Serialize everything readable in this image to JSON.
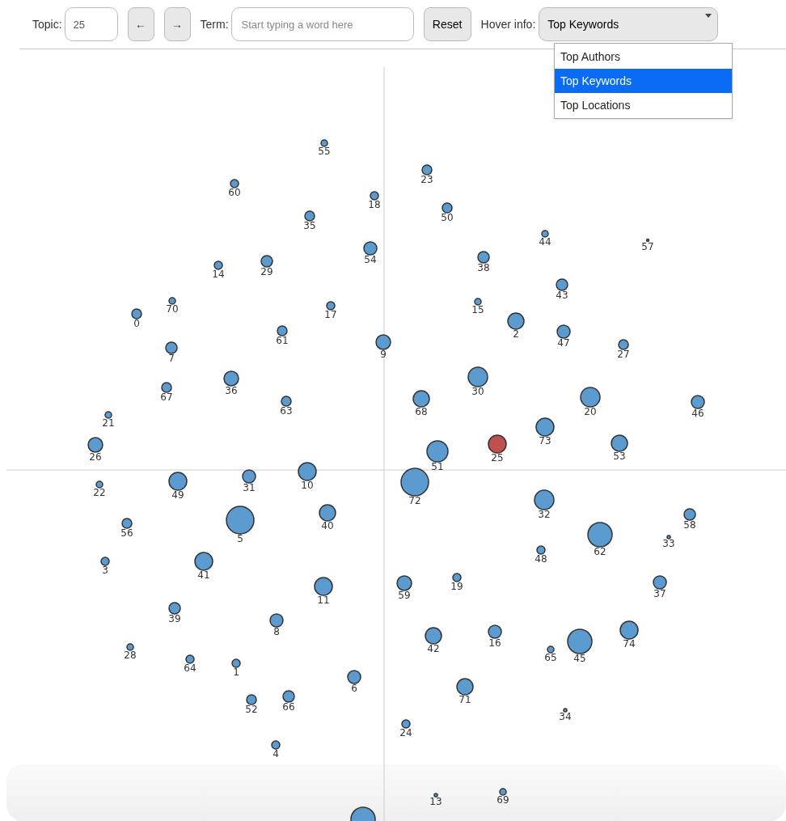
{
  "toolbar": {
    "topic_label": "Topic:",
    "topic_value": "25",
    "prev_button": "←",
    "next_button": "→",
    "term_label": "Term:",
    "term_placeholder": "Start typing a word here",
    "reset_button": "Reset",
    "hover_label": "Hover info:",
    "hover_value": "Top Keywords",
    "hover_expanded": true,
    "hover_options": [
      {
        "label": "Top Authors",
        "selected": false
      },
      {
        "label": "Top Keywords",
        "selected": true
      },
      {
        "label": "Top Locations",
        "selected": false
      }
    ]
  },
  "topics": [
    {
      "label": "55",
      "selected": false
    },
    {
      "label": "23",
      "selected": false
    },
    {
      "label": "60",
      "selected": false
    },
    {
      "label": "18",
      "selected": false
    },
    {
      "label": "50",
      "selected": false
    },
    {
      "label": "35",
      "selected": false
    },
    {
      "label": "44",
      "selected": false
    },
    {
      "label": "57",
      "selected": false
    },
    {
      "label": "54",
      "selected": false
    },
    {
      "label": "14",
      "selected": false
    },
    {
      "label": "29",
      "selected": false
    },
    {
      "label": "38",
      "selected": false
    },
    {
      "label": "43",
      "selected": false
    },
    {
      "label": "70",
      "selected": false
    },
    {
      "label": "17",
      "selected": false
    },
    {
      "label": "15",
      "selected": false
    },
    {
      "label": "0",
      "selected": false
    },
    {
      "label": "2",
      "selected": false
    },
    {
      "label": "61",
      "selected": false
    },
    {
      "label": "47",
      "selected": false
    },
    {
      "label": "7",
      "selected": false
    },
    {
      "label": "9",
      "selected": false
    },
    {
      "label": "27",
      "selected": false
    },
    {
      "label": "67",
      "selected": false
    },
    {
      "label": "36",
      "selected": false
    },
    {
      "label": "30",
      "selected": false
    },
    {
      "label": "63",
      "selected": false
    },
    {
      "label": "68",
      "selected": false
    },
    {
      "label": "20",
      "selected": false
    },
    {
      "label": "46",
      "selected": false
    },
    {
      "label": "21",
      "selected": false
    },
    {
      "label": "73",
      "selected": false
    },
    {
      "label": "26",
      "selected": false
    },
    {
      "label": "25",
      "selected": true
    },
    {
      "label": "53",
      "selected": false
    },
    {
      "label": "51",
      "selected": false
    },
    {
      "label": "22",
      "selected": false
    },
    {
      "label": "49",
      "selected": false
    },
    {
      "label": "31",
      "selected": false
    },
    {
      "label": "10",
      "selected": false
    },
    {
      "label": "72",
      "selected": false
    },
    {
      "label": "32",
      "selected": false
    },
    {
      "label": "40",
      "selected": false
    },
    {
      "label": "58",
      "selected": false
    },
    {
      "label": "56",
      "selected": false
    },
    {
      "label": "5",
      "selected": false
    },
    {
      "label": "33",
      "selected": false
    },
    {
      "label": "62",
      "selected": false
    },
    {
      "label": "48",
      "selected": false
    },
    {
      "label": "3",
      "selected": false
    },
    {
      "label": "41",
      "selected": false
    },
    {
      "label": "19",
      "selected": false
    },
    {
      "label": "11",
      "selected": false
    },
    {
      "label": "59",
      "selected": false
    },
    {
      "label": "37",
      "selected": false
    },
    {
      "label": "39",
      "selected": false
    },
    {
      "label": "8",
      "selected": false
    },
    {
      "label": "28",
      "selected": false
    },
    {
      "label": "42",
      "selected": false
    },
    {
      "label": "16",
      "selected": false
    },
    {
      "label": "65",
      "selected": false
    },
    {
      "label": "45",
      "selected": false
    },
    {
      "label": "74",
      "selected": false
    },
    {
      "label": "64",
      "selected": false
    },
    {
      "label": "1",
      "selected": false
    },
    {
      "label": "6",
      "selected": false
    },
    {
      "label": "71",
      "selected": false
    },
    {
      "label": "52",
      "selected": false
    },
    {
      "label": "66",
      "selected": false
    },
    {
      "label": "34",
      "selected": false
    },
    {
      "label": "24",
      "selected": false
    },
    {
      "label": "4",
      "selected": false
    },
    {
      "label": "13",
      "selected": false
    },
    {
      "label": "69",
      "selected": false
    },
    {
      "selected": false
    }
  ]
}
